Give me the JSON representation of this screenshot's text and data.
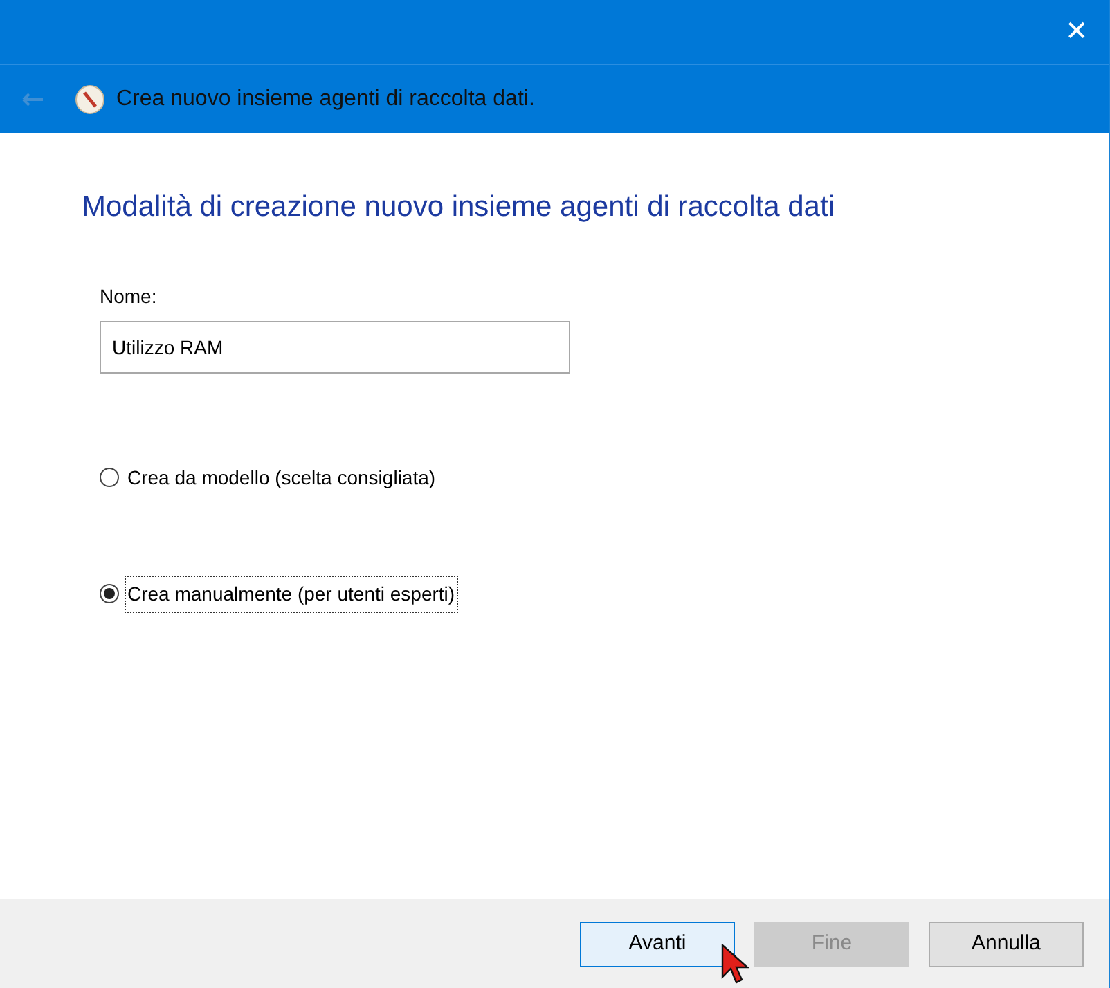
{
  "window": {
    "close": "✕"
  },
  "header": {
    "title": "Crea nuovo insieme agenti di raccolta dati."
  },
  "heading": "Modalità di creazione nuovo insieme agenti di raccolta dati",
  "name_field": {
    "label": "Nome:",
    "value": "Utilizzo RAM"
  },
  "options": [
    {
      "label": "Crea da modello (scelta consigliata)",
      "selected": false,
      "focused": false
    },
    {
      "label": "Crea manualmente (per utenti esperti)",
      "selected": true,
      "focused": true
    }
  ],
  "buttons": [
    {
      "label": "Avanti",
      "disabled": false,
      "default": true
    },
    {
      "label": "Fine",
      "disabled": true,
      "default": false
    },
    {
      "label": "Annulla",
      "disabled": false,
      "default": false
    }
  ]
}
